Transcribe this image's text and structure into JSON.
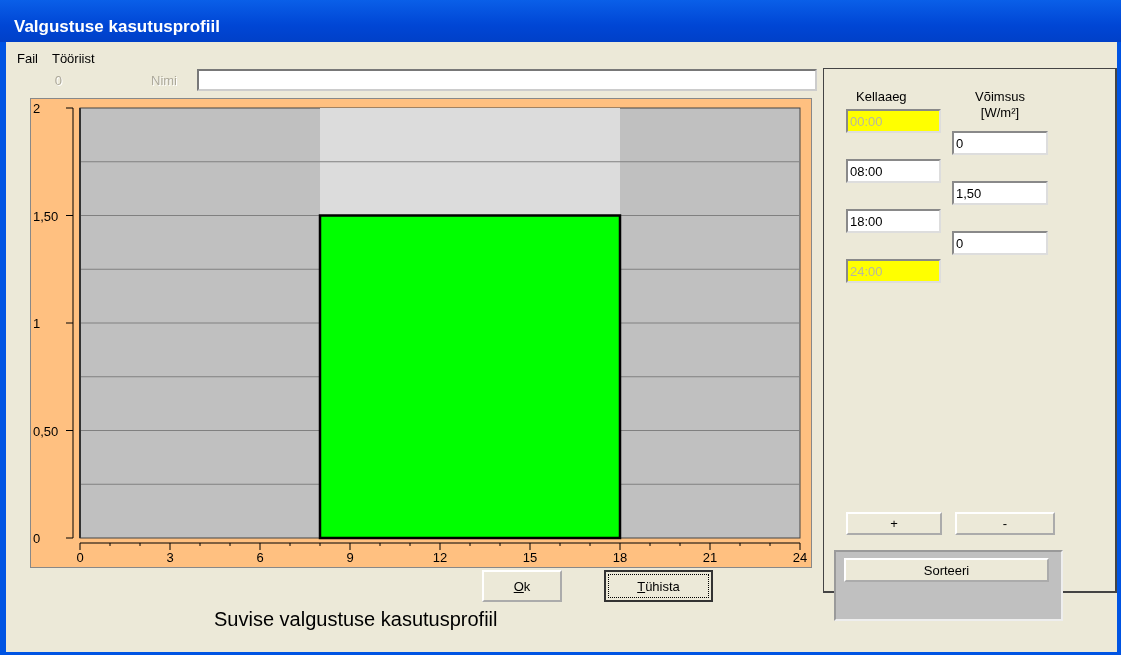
{
  "window": {
    "title": "Valgustuse kasutusprofiil"
  },
  "menu": [
    "Fail",
    "Tööriist"
  ],
  "name_row": {
    "number": "0",
    "label": "Nimi"
  },
  "chart": {
    "chart_data": {
      "type": "area",
      "x": [
        8,
        18
      ],
      "series": [
        {
          "color": "#dcdcdc",
          "values": [
            2,
            2
          ]
        },
        {
          "color": "#00ff00",
          "values": [
            1.5,
            1.5
          ]
        }
      ],
      "grid": true,
      "xlim": [
        0,
        24
      ],
      "ylim": [
        0,
        2
      ],
      "xticks": [
        0,
        3,
        6,
        9,
        12,
        15,
        18,
        21,
        24
      ],
      "yticks": [
        {
          "value": 0,
          "label": "0"
        },
        {
          "value": 0.5,
          "label": "0,50"
        },
        {
          "value": 1,
          "label": "1"
        },
        {
          "value": 1.5,
          "label": "1,50"
        },
        {
          "value": 2,
          "label": "2"
        }
      ]
    }
  },
  "buttons": [
    {
      "label": "Ok",
      "focused": false
    },
    {
      "label": "Tühista",
      "focused": true
    }
  ],
  "caption": "Suvise valgustuse kasutusprofiil",
  "panel": {
    "time_header": "Kellaaeg",
    "power_header": [
      "Võimsus",
      "[W/m²]"
    ],
    "times": [
      {
        "value": "00:00",
        "disabled": true
      },
      {
        "value": "08:00",
        "disabled": false
      },
      {
        "value": "18:00",
        "disabled": false
      },
      {
        "value": "24:00",
        "disabled": true
      }
    ],
    "powers": [
      "0",
      "1,50",
      "0"
    ],
    "add_button": "+",
    "remove_button": "-",
    "sort_button": "Sorteeri"
  }
}
